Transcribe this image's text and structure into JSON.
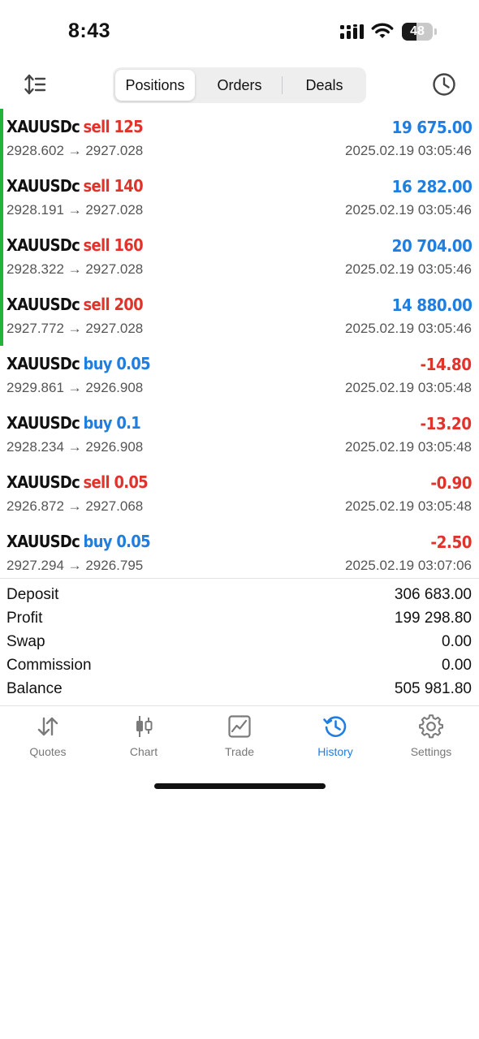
{
  "status_bar": {
    "time": "8:43",
    "battery_level": "48"
  },
  "toolbar": {
    "tabs": [
      {
        "label": "Positions",
        "active": true
      },
      {
        "label": "Orders",
        "active": false
      },
      {
        "label": "Deals",
        "active": false
      }
    ]
  },
  "colors": {
    "sell": "#e0332b",
    "buy": "#1f7ee0",
    "profit_positive": "#1f7ee0",
    "profit_negative": "#e0332b",
    "marker_green": "#22b33a",
    "active_tab": "#1f7ee0"
  },
  "deals": [
    {
      "symbol": "XAUUSDc",
      "side": "sell 125",
      "type": "sell",
      "profit": "19 675.00",
      "profit_sign": "positive",
      "prices": "2928.602 → 2927.028",
      "time": "2025.02.19 03:05:46",
      "marker": true
    },
    {
      "symbol": "XAUUSDc",
      "side": "sell 140",
      "type": "sell",
      "profit": "16 282.00",
      "profit_sign": "positive",
      "prices": "2928.191 → 2927.028",
      "time": "2025.02.19 03:05:46",
      "marker": true
    },
    {
      "symbol": "XAUUSDc",
      "side": "sell 160",
      "type": "sell",
      "profit": "20 704.00",
      "profit_sign": "positive",
      "prices": "2928.322 → 2927.028",
      "time": "2025.02.19 03:05:46",
      "marker": true
    },
    {
      "symbol": "XAUUSDc",
      "side": "sell 200",
      "type": "sell",
      "profit": "14 880.00",
      "profit_sign": "positive",
      "prices": "2927.772 → 2927.028",
      "time": "2025.02.19 03:05:46",
      "marker": true
    },
    {
      "symbol": "XAUUSDc",
      "side": "buy 0.05",
      "type": "buy",
      "profit": "-14.80",
      "profit_sign": "negative",
      "prices": "2929.861 → 2926.908",
      "time": "2025.02.19 03:05:48",
      "marker": false
    },
    {
      "symbol": "XAUUSDc",
      "side": "buy 0.1",
      "type": "buy",
      "profit": "-13.20",
      "profit_sign": "negative",
      "prices": "2928.234 → 2926.908",
      "time": "2025.02.19 03:05:48",
      "marker": false
    },
    {
      "symbol": "XAUUSDc",
      "side": "sell 0.05",
      "type": "sell",
      "profit": "-0.90",
      "profit_sign": "negative",
      "prices": "2926.872 → 2927.068",
      "time": "2025.02.19 03:05:48",
      "marker": false
    },
    {
      "symbol": "XAUUSDc",
      "side": "buy 0.05",
      "type": "buy",
      "profit": "-2.50",
      "profit_sign": "negative",
      "prices": "2927.294 → 2926.795",
      "time": "2025.02.19 03:07:06",
      "marker": false
    }
  ],
  "summary": [
    {
      "label": "Deposit",
      "value": "306 683.00"
    },
    {
      "label": "Profit",
      "value": "199 298.80"
    },
    {
      "label": "Swap",
      "value": "0.00"
    },
    {
      "label": "Commission",
      "value": "0.00"
    },
    {
      "label": "Balance",
      "value": "505 981.80"
    }
  ],
  "tab_bar": [
    {
      "label": "Quotes",
      "icon": "quotes-arrows-icon",
      "active": false
    },
    {
      "label": "Chart",
      "icon": "candlestick-chart-icon",
      "active": false
    },
    {
      "label": "Trade",
      "icon": "trade-chart-icon",
      "active": false
    },
    {
      "label": "History",
      "icon": "history-clock-icon",
      "active": true
    },
    {
      "label": "Settings",
      "icon": "gear-icon",
      "active": false
    }
  ]
}
